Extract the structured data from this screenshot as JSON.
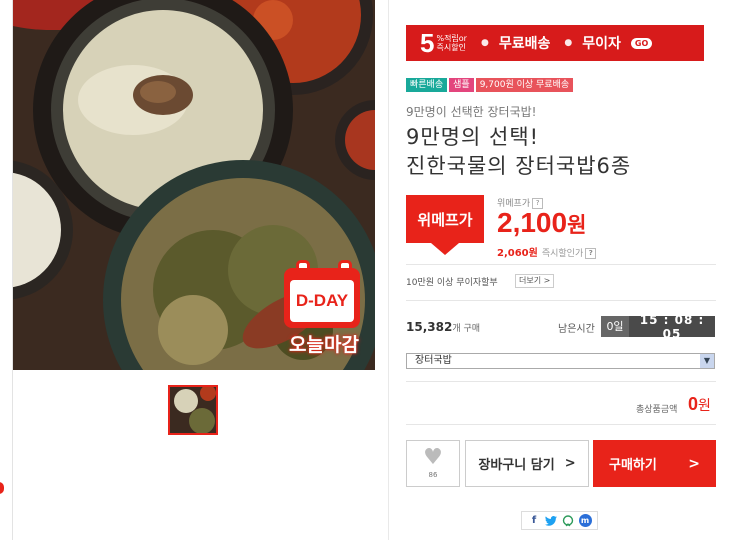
{
  "banner": {
    "five": "5",
    "five_sub_line1": "%적립or",
    "five_sub_line2": "즉시할인",
    "free_shipping": "무료배송",
    "no_interest": "무이자",
    "go": "GO"
  },
  "badges": [
    {
      "label": "빠른배송"
    },
    {
      "label": "샘플"
    },
    {
      "label": "9,700원 이상 무료배송"
    }
  ],
  "product": {
    "subtitle": "9만명이 선택한 장터국밥!",
    "title_line1": "9만명의 선택!",
    "title_line2": "진한국물의 장터국밥6종"
  },
  "dday": {
    "label": "D-DAY",
    "caption": "오늘마감"
  },
  "price": {
    "flag": "위메프가",
    "label": "위메프가",
    "value": "2,100",
    "unit": "원",
    "instant_value": "2,060원",
    "instant_label": "즉시할인가"
  },
  "installment": {
    "text": "10만원 이상 무이자할부",
    "more": "더보기"
  },
  "sales": {
    "count": "15,382",
    "unit": "개 구매",
    "remain_label": "남은시간",
    "days": "0일",
    "time": "15 : 08 : 05"
  },
  "option": {
    "selected": "장터국밥"
  },
  "total": {
    "label": "총상품금액",
    "value": "0",
    "unit": "원"
  },
  "actions": {
    "wish_count": "86",
    "cart": "장바구니 담기",
    "buy": "구매하기"
  },
  "share": {
    "facebook": "f",
    "kakao": "m"
  }
}
